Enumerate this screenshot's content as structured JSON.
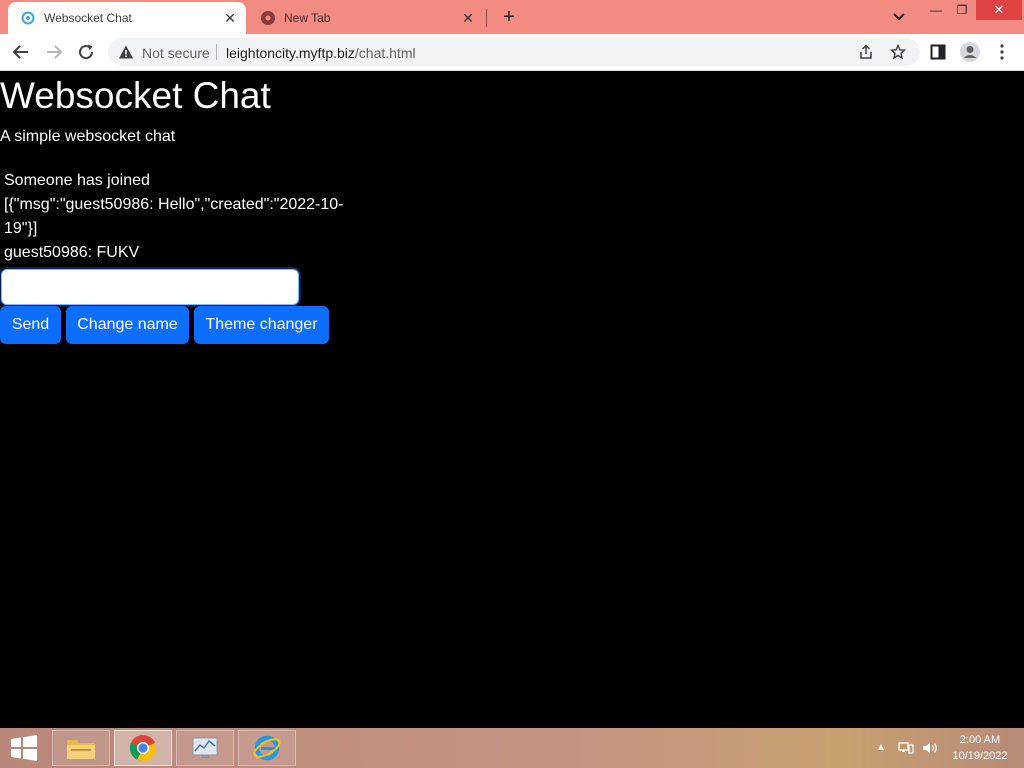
{
  "browser": {
    "tabs": [
      {
        "title": "Websocket Chat",
        "active": true,
        "icon": "websocket-favicon"
      },
      {
        "title": "New Tab",
        "active": false,
        "icon": "chrome-icon"
      }
    ],
    "address_bar": {
      "security_label": "Not secure",
      "host": "leightoncity.myftp.biz",
      "path": "/chat.html"
    },
    "colors": {
      "tabstrip": "#f28b82"
    }
  },
  "page": {
    "title": "Websocket Chat",
    "subtitle": "A simple websocket chat",
    "messages": [
      "Someone has joined",
      "[{\"msg\":\"guest50986: Hello\",\"created\":\"2022-10-19\"}]",
      "guest50986: FUKV"
    ],
    "input": {
      "value": "",
      "placeholder": ""
    },
    "buttons": {
      "send": "Send",
      "change_name": "Change name",
      "theme_changer": "Theme changer"
    },
    "colors": {
      "background": "#000000",
      "text": "#ffffff",
      "button": "#0d6efd"
    }
  },
  "taskbar": {
    "apps": [
      "file-explorer",
      "chrome",
      "resource-monitor",
      "internet-explorer"
    ],
    "clock": {
      "time": "2:00 AM",
      "date": "10/19/2022"
    }
  }
}
